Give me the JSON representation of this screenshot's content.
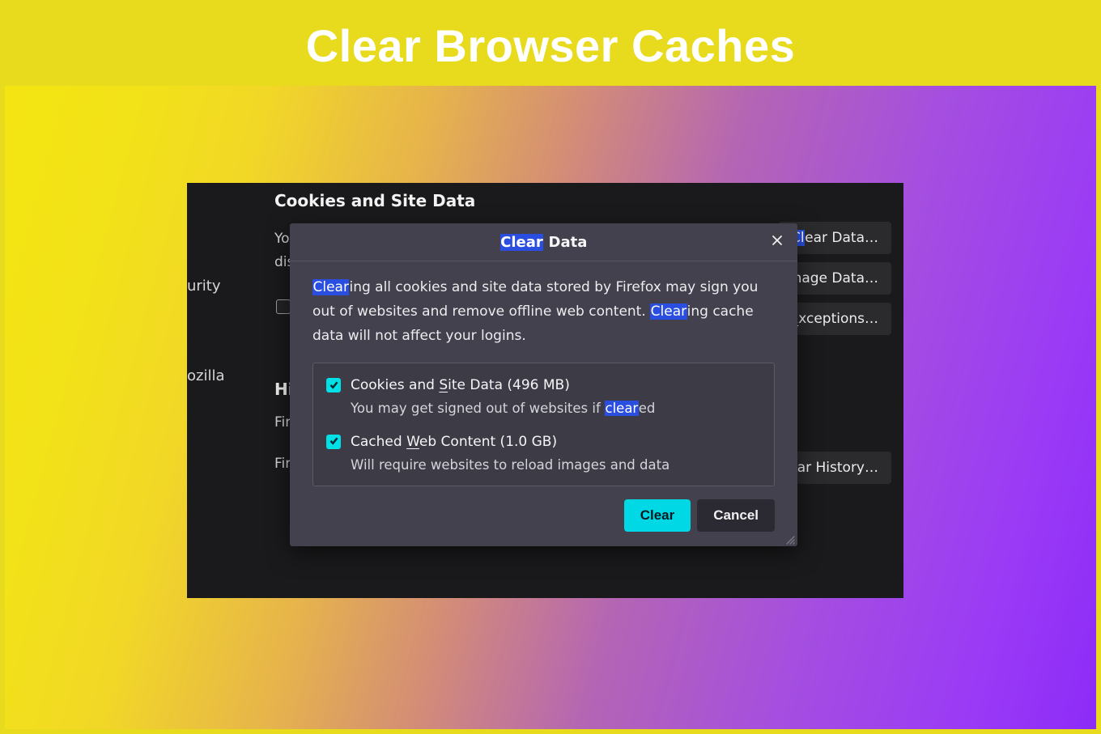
{
  "banner": {
    "title": "Clear Browser Caches"
  },
  "background": {
    "section_heading": "Cookies and Site Data",
    "line1a": "Yo",
    "line1b": "dis",
    "left_partial_1": "urity",
    "left_partial_2": "ozilla",
    "btn_clear_data_prefix": "ear Data…",
    "btn_manage_data_prefix": "nage Data…",
    "btn_exceptions": "Exceptions…",
    "hist_heading": "Hi",
    "fir1": "Fir",
    "fir2": "Fir",
    "btn_clear_history_prefix": "ar History…"
  },
  "dialog": {
    "title_hl": "Clear",
    "title_rest": " Data",
    "body_hl1": "Clear",
    "body_part1": "ing all cookies and site data stored by Firefox may sign you out of websites and remove offline web content. ",
    "body_hl2": "Clear",
    "body_part2": "ing cache data will not affect your logins.",
    "options": [
      {
        "checked": true,
        "label_pre": "Cookies and ",
        "label_ul": "S",
        "label_post": "ite Data (496 MB)",
        "desc_pre": "You may get signed out of websites if ",
        "desc_hl": "clear",
        "desc_post": "ed"
      },
      {
        "checked": true,
        "label_pre": "Cached ",
        "label_ul": "W",
        "label_post": "eb Content (1.0 GB)",
        "desc_plain": "Will require websites to reload images and data"
      }
    ],
    "buttons": {
      "clear": "Clear",
      "cancel": "Cancel"
    }
  }
}
